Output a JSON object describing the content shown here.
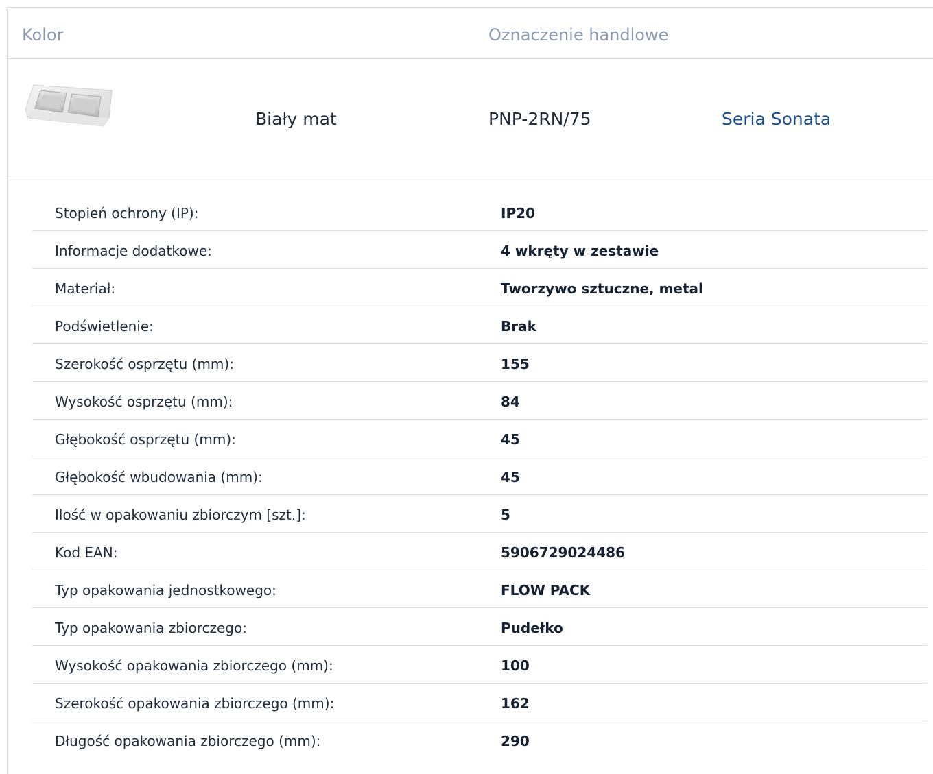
{
  "header": {
    "color_label": "Kolor",
    "trade_label": "Oznaczenie handlowe"
  },
  "product": {
    "image_icon": "double-socket-frame-image",
    "color": "Biały mat",
    "code": "PNP-2RN/75",
    "series": "Seria Sonata",
    "series_color": "#1b4e8c"
  },
  "specs": [
    {
      "label": "Stopień ochrony (IP):",
      "value": "IP20"
    },
    {
      "label": "Informacje dodatkowe:",
      "value": "4 wkręty w zestawie"
    },
    {
      "label": "Materiał:",
      "value": "Tworzywo sztuczne, metal"
    },
    {
      "label": "Podświetlenie:",
      "value": "Brak"
    },
    {
      "label": "Szerokość osprzętu (mm):",
      "value": "155"
    },
    {
      "label": "Wysokość osprzętu (mm):",
      "value": "84"
    },
    {
      "label": "Głębokość osprzętu (mm):",
      "value": "45"
    },
    {
      "label": "Głębokość wbudowania (mm):",
      "value": "45"
    },
    {
      "label": "Ilość w opakowaniu zbiorczym [szt.]:",
      "value": "5"
    },
    {
      "label": "Kod EAN:",
      "value": "5906729024486"
    },
    {
      "label": "Typ opakowania jednostkowego:",
      "value": "FLOW PACK"
    },
    {
      "label": "Typ opakowania zbiorczego:",
      "value": "Pudełko"
    },
    {
      "label": "Wysokość opakowania zbiorczego (mm):",
      "value": "100"
    },
    {
      "label": "Szerokość opakowania zbiorczego (mm):",
      "value": "162"
    },
    {
      "label": "Długość opakowania zbiorczego (mm):",
      "value": "290"
    }
  ]
}
